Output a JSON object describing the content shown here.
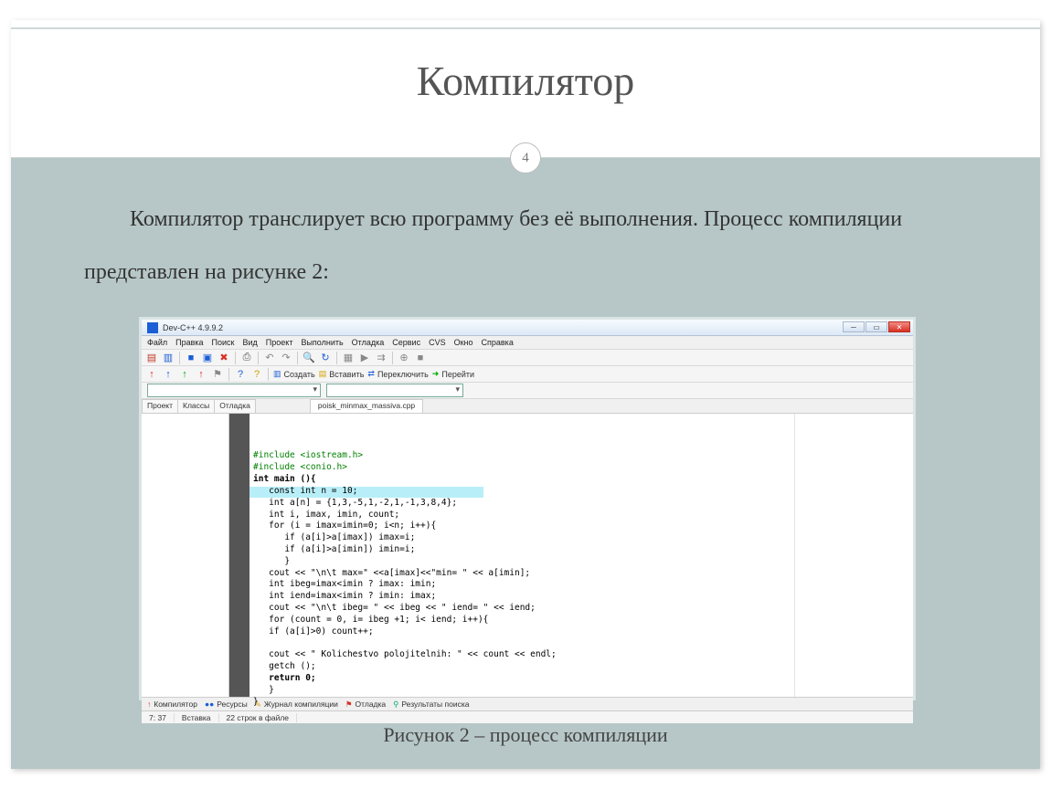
{
  "slide": {
    "title": "Компилятор",
    "page_number": "4",
    "body_text": "Компилятор транслирует всю программу без её выполнения. Процесс компиляции представлен на рисунке 2:",
    "caption": "Рисунок 2 –  процесс компиляции"
  },
  "ide": {
    "window_title": "Dev-C++ 4.9.9.2",
    "menu": [
      "Файл",
      "Правка",
      "Поиск",
      "Вид",
      "Проект",
      "Выполнить",
      "Отладка",
      "Сервис",
      "CVS",
      "Окно",
      "Справка"
    ],
    "toolbar2": {
      "create": "Создать",
      "insert": "Вставить",
      "switch": "Переключить",
      "goto": "Перейти"
    },
    "side_tabs": [
      "Проект",
      "Классы",
      "Отладка"
    ],
    "file_tab": "poisk_minmax_massiva.cpp",
    "bottom_tabs": [
      "Компилятор",
      "Ресурсы",
      "Журнал компиляции",
      "Отладка",
      "Результаты поиска"
    ],
    "status": {
      "pos": "7: 37",
      "mode": "Вставка",
      "lines": "22 строк в файле"
    },
    "code_lines": [
      {
        "t": "#include <iostream.h>",
        "cls": "pp"
      },
      {
        "t": "#include <conio.h>",
        "cls": "pp"
      },
      {
        "t": "int main (){",
        "cls": "kw"
      },
      {
        "t": "   const int n = 10;",
        "cls": ""
      },
      {
        "t": "   int a[n] = {1,3,-5,1,-2,1,-1,3,8,4};",
        "cls": ""
      },
      {
        "t": "   int i, imax, imin, count;",
        "cls": ""
      },
      {
        "t": "   for (i = imax=imin=0; i<n; i++){",
        "cls": "",
        "hl": true
      },
      {
        "t": "      if (a[i]>a[imax]) imax=i;",
        "cls": ""
      },
      {
        "t": "      if (a[i]>a[imin]) imin=i;",
        "cls": ""
      },
      {
        "t": "      }",
        "cls": ""
      },
      {
        "t": "   cout << \"\\n\\t max=\" <<a[imax]<<\"min= \" << a[imin];",
        "cls": "str-mix"
      },
      {
        "t": "   int ibeg=imax<imin ? imax: imin;",
        "cls": ""
      },
      {
        "t": "   int iend=imax<imin ? imin: imax;",
        "cls": ""
      },
      {
        "t": "   cout << \"\\n\\t ibeg= \" << ibeg << \" iend= \" << iend;",
        "cls": "str-mix"
      },
      {
        "t": "   for (count = 0, i= ibeg +1; i< iend; i++){",
        "cls": ""
      },
      {
        "t": "   if (a[i]>0) count++;",
        "cls": ""
      },
      {
        "t": "",
        "cls": ""
      },
      {
        "t": "   cout << \" Kolichestvo polojitelnih: \" << count << endl;",
        "cls": "str-mix"
      },
      {
        "t": "   getch ();",
        "cls": ""
      },
      {
        "t": "   return 0;",
        "cls": "kw"
      },
      {
        "t": "   }",
        "cls": ""
      },
      {
        "t": "}",
        "cls": ""
      }
    ]
  }
}
